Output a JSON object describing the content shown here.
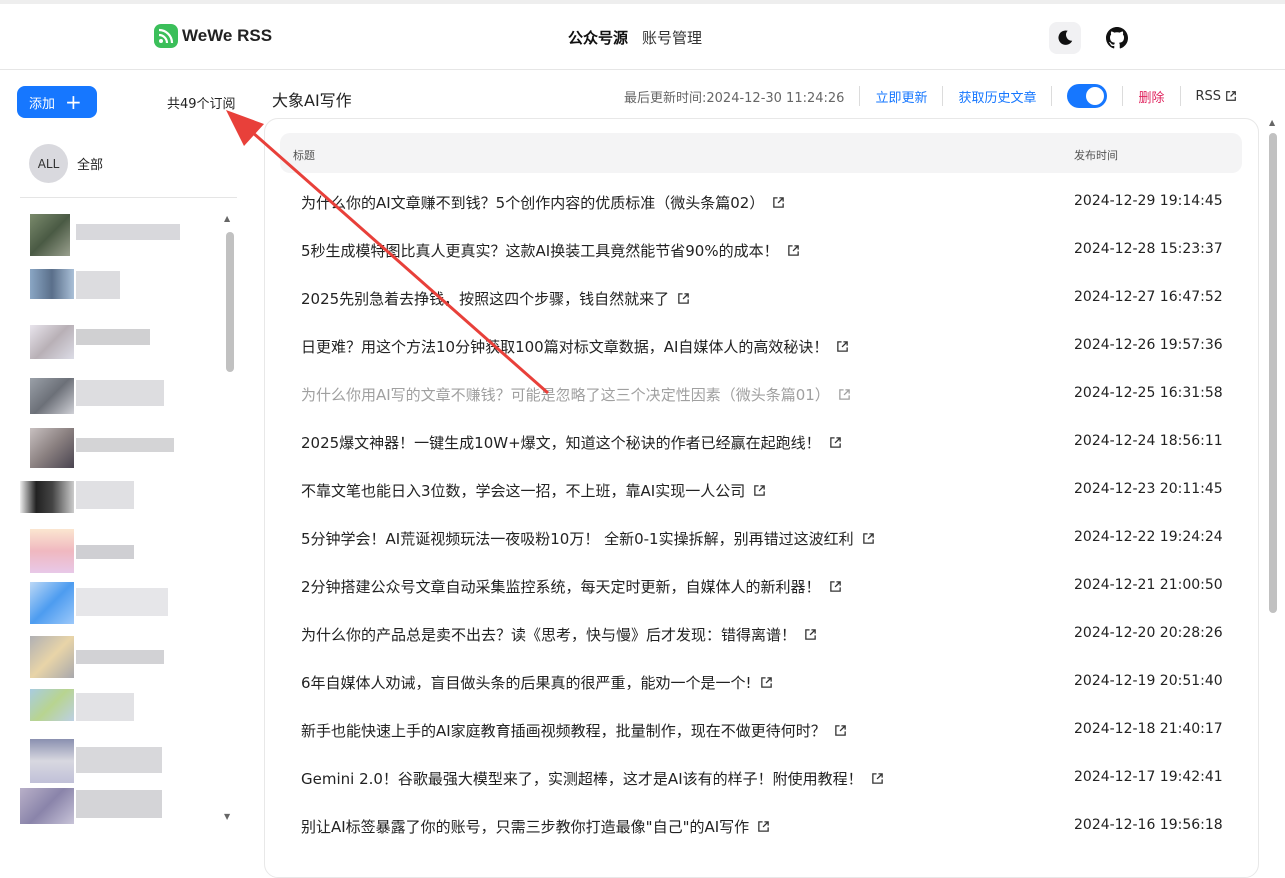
{
  "app": {
    "name": "WeWe RSS"
  },
  "nav": {
    "tab_feeds": "公众号源",
    "tab_accounts": "账号管理"
  },
  "icons": {
    "theme": "moon-icon",
    "github": "github-icon"
  },
  "sidebar": {
    "add_label": "添加",
    "add_icon": "+",
    "subscription_count": "共49个订阅",
    "all_avatar": "ALL",
    "all_label": "全部"
  },
  "feed": {
    "name": "大象AI写作",
    "last_update": "最后更新时间:2024-12-30 11:24:26",
    "refresh_label": "立即更新",
    "history_label": "获取历史文章",
    "enabled": true,
    "delete_label": "删除",
    "rss_label": "RSS"
  },
  "table": {
    "col_title": "标题",
    "col_time": "发布时间",
    "rows": [
      {
        "title": "为什么你的AI文章赚不到钱？5个创作内容的优质标准（微头条篇02）",
        "time": "2024-12-29 19:14:45",
        "read": false
      },
      {
        "title": "5秒生成模特图比真人更真实？这款AI换装工具竟然能节省90%的成本！",
        "time": "2024-12-28 15:23:37",
        "read": false
      },
      {
        "title": "2025先别急着去挣钱，按照这四个步骤，钱自然就来了",
        "time": "2024-12-27 16:47:52",
        "read": false
      },
      {
        "title": "日更难？用这个方法10分钟获取100篇对标文章数据，AI自媒体人的高效秘诀！",
        "time": "2024-12-26 19:57:36",
        "read": false
      },
      {
        "title": "为什么你用AI写的文章不赚钱？可能是忽略了这三个决定性因素（微头条篇01）",
        "time": "2024-12-25 16:31:58",
        "read": true
      },
      {
        "title": "2025爆文神器！一键生成10W+爆文，知道这个秘诀的作者已经赢在起跑线！",
        "time": "2024-12-24 18:56:11",
        "read": false
      },
      {
        "title": "不靠文笔也能日入3位数，学会这一招，不上班，靠AI实现一人公司",
        "time": "2024-12-23 20:11:45",
        "read": false
      },
      {
        "title": "5分钟学会！AI荒诞视频玩法一夜吸粉10万！ 全新0-1实操拆解，别再错过这波红利",
        "time": "2024-12-22 19:24:24",
        "read": false
      },
      {
        "title": "2分钟搭建公众号文章自动采集监控系统，每天定时更新，自媒体人的新利器！",
        "time": "2024-12-21 21:00:50",
        "read": false
      },
      {
        "title": "为什么你的产品总是卖不出去？读《思考，快与慢》后才发现：错得离谱！",
        "time": "2024-12-20 20:28:26",
        "read": false
      },
      {
        "title": "6年自媒体人劝诫，盲目做头条的后果真的很严重，能劝一个是一个!",
        "time": "2024-12-19 20:51:40",
        "read": false
      },
      {
        "title": "新手也能快速上手的AI家庭教育插画视频教程，批量制作，现在不做更待何时？",
        "time": "2024-12-18 21:40:17",
        "read": false
      },
      {
        "title": "Gemini 2.0！谷歌最强大模型来了，实测超棒，这才是AI该有的样子！附使用教程！",
        "time": "2024-12-17 19:42:41",
        "read": false
      },
      {
        "title": "别让AI标签暴露了你的账号，只需三步教你打造最像\"自己\"的AI写作",
        "time": "2024-12-16 19:56:18",
        "read": false
      }
    ]
  },
  "colors": {
    "accent": "#1677ff",
    "danger": "#e0245e",
    "annotation_arrow": "#e8403a",
    "logo": "#3bbf5a"
  }
}
